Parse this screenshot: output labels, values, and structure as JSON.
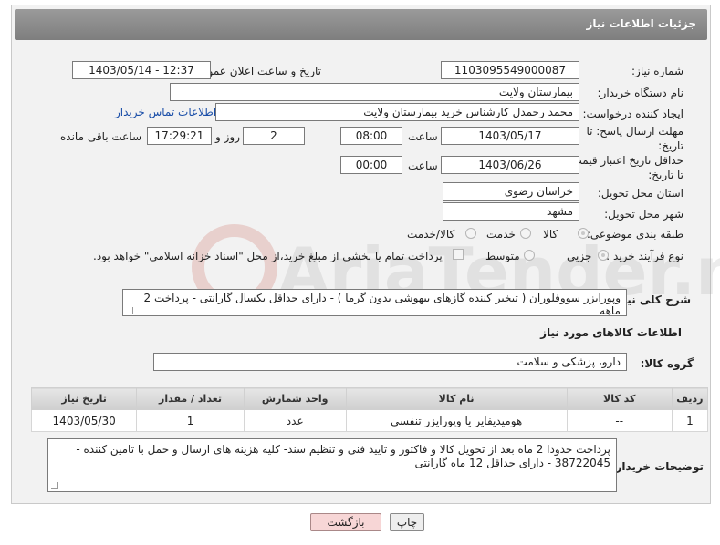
{
  "header": {
    "title": "جزئیات اطلاعات نیاز"
  },
  "form": {
    "need_number": {
      "label": "شماره نیاز:",
      "value": "1103095549000087"
    },
    "announce_datetime": {
      "label": "تاریخ و ساعت اعلان عمومی:",
      "value": "1403/05/14 - 12:37"
    },
    "buyer_org": {
      "label": "نام دستگاه خریدار:",
      "value": "بیمارستان ولایت"
    },
    "requester": {
      "label": "ایجاد کننده درخواست:",
      "value": "محمد رحمدل کارشناس خرید بیمارستان ولایت",
      "contact_link": "اطلاعات تماس خریدار"
    },
    "reply_deadline": {
      "label": "مهلت ارسال پاسخ: تا تاریخ:",
      "date": "1403/05/17",
      "time_label": "ساعت",
      "time": "08:00",
      "days": "2",
      "days_label": "روز و",
      "remaining": "17:29:21",
      "remaining_label": "ساعت باقی مانده"
    },
    "price_validity": {
      "label": "حداقل تاریخ اعتبار قیمت: تا تاریخ:",
      "date": "1403/06/26",
      "time_label": "ساعت",
      "time": "00:00"
    },
    "province": {
      "label": "استان محل تحویل:",
      "value": "خراسان رضوی"
    },
    "city": {
      "label": "شهر محل تحویل:",
      "value": "مشهد"
    },
    "category": {
      "label": "طبقه بندی موضوعی:",
      "options": [
        "کالا",
        "خدمت",
        "کالا/خدمت"
      ],
      "selected": "کالا"
    },
    "process_type": {
      "label": "نوع فرآیند خرید :",
      "options": [
        "جزیی",
        "متوسط"
      ],
      "selected": "جزیی",
      "payment_note": "پرداخت تمام یا بخشی از مبلغ خرید،از محل \"اسناد خزانه اسلامی\" خواهد بود."
    },
    "summary": {
      "label": "شرح کلی نیاز:",
      "value": "وپورایزر سووفلوران ( تبخیر کننده گازهای بیهوشی بدون گرما ) - دارای حداقل یکسال گارانتی - پرداخت 2 ماهه"
    }
  },
  "goods_section": {
    "title": "اطلاعات کالاهای مورد نیاز",
    "group_label": "گروه کالا:",
    "group_value": "دارو، پزشکی و سلامت",
    "table": {
      "headers": [
        "ردیف",
        "کد کالا",
        "نام کالا",
        "واحد شمارش",
        "تعداد / مقدار",
        "تاریخ نیاز"
      ],
      "rows": [
        [
          "1",
          "--",
          "هومیدیفایر یا وپورایزر تنفسی",
          "عدد",
          "1",
          "1403/05/30"
        ]
      ]
    }
  },
  "buyer_notes": {
    "label": "توضیحات خریدار:",
    "value": "پرداخت حدودا 2 ماه بعد از تحویل کالا و فاکتور و تایید فنی و تنظیم سند- کلیه هزینه های ارسال و حمل با تامین کننده - 38722045 - دارای حداقل 12 ماه گارانتی"
  },
  "buttons": {
    "print": "چاپ",
    "back": "بازگشت"
  },
  "watermark_text": "AriaTender.net"
}
